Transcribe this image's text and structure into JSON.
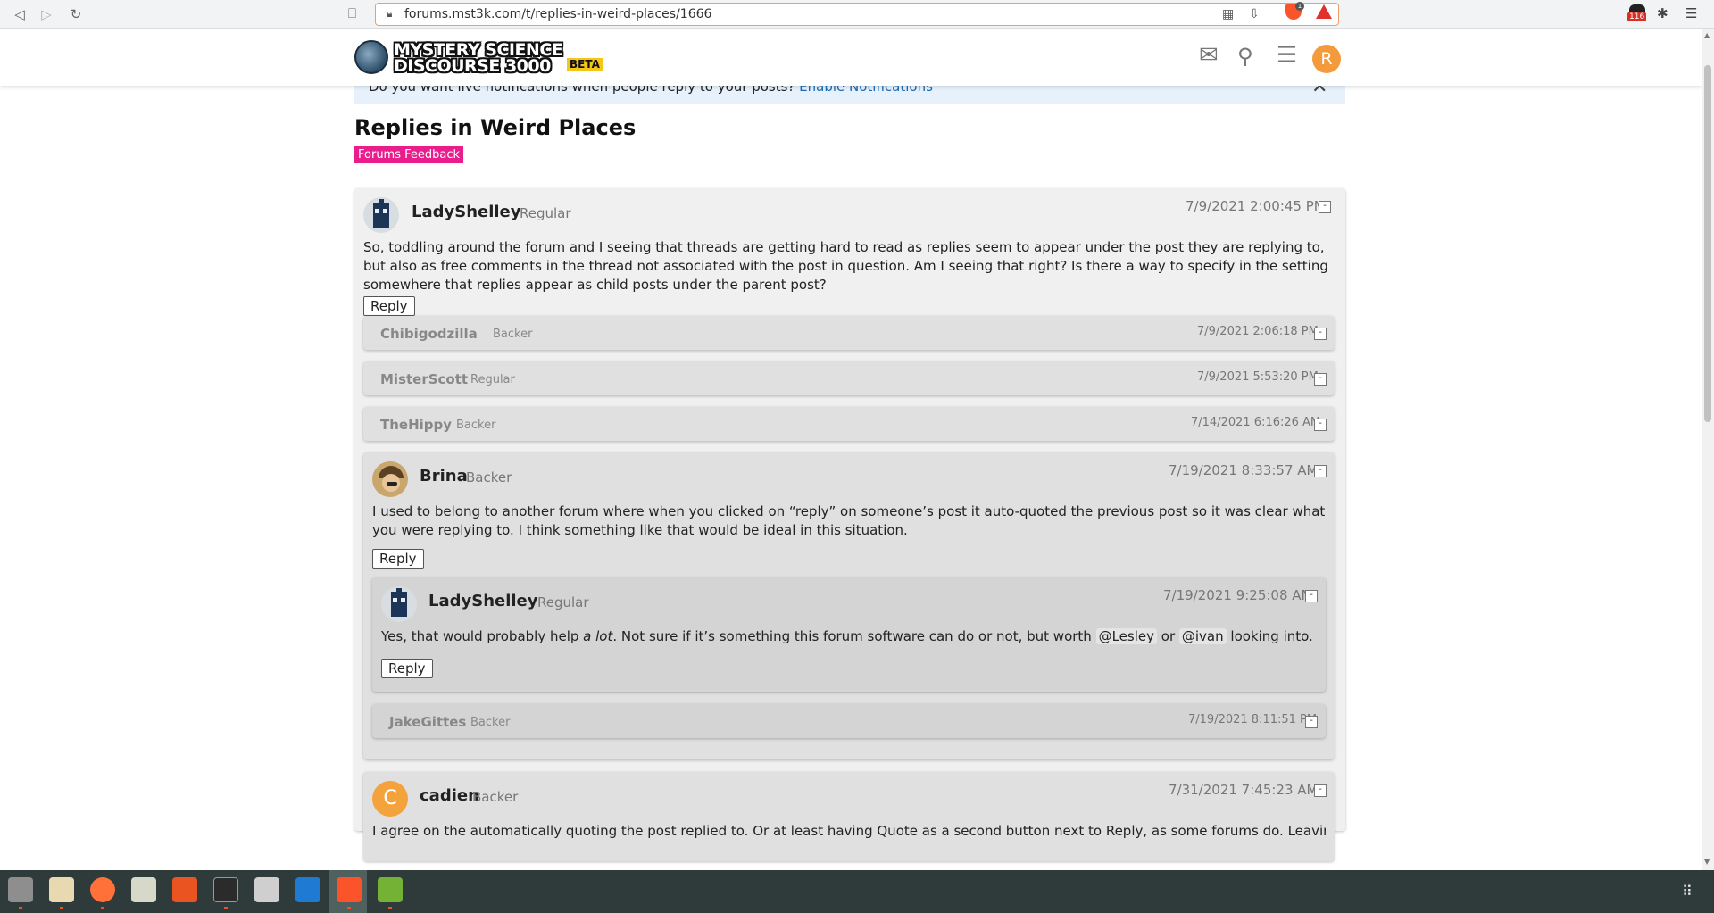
{
  "browser": {
    "url": "forums.mst3k.com/t/replies-in-weird-places/1666",
    "shield_count": "1",
    "extension_badge": "116"
  },
  "site": {
    "logo_line1": "MYSTERY SCIENCE",
    "logo_line2": "DISCOURSE 3000",
    "logo_beta": "BETA",
    "avatar_letter": "R"
  },
  "notice": {
    "text": "Do you want live notifications when people reply to your posts?",
    "link": "Enable Notifications"
  },
  "topic": {
    "title": "Replies in Weird Places",
    "category": "Forums Feedback",
    "category_color": "#e91e8c"
  },
  "reply_label": "Reply",
  "collapse_symbol": "-",
  "posts": {
    "p1": {
      "user": "LadyShelley",
      "role": "Regular",
      "time": "7/9/2021 2:00:45 PM",
      "body": "So, toddling around the forum and I seeing that threads are getting hard to read as replies seem to appear under the post they are replying to, but also as free comments in the thread not associated with the post in question. Am I seeing that right? Is there a way to specify in the setting somewhere that replies appear as child posts under the parent post?"
    },
    "c1": {
      "user": "Chibigodzilla",
      "role": "Backer",
      "time": "7/9/2021 2:06:18 PM"
    },
    "c2": {
      "user": "MisterScott",
      "role": "Regular",
      "time": "7/9/2021 5:53:20 PM"
    },
    "c3": {
      "user": "TheHippy",
      "role": "Backer",
      "time": "7/14/2021 6:16:26 AM"
    },
    "p2": {
      "user": "Brina",
      "role": "Backer",
      "time": "7/19/2021 8:33:57 AM",
      "body": "I used to belong to another forum where when you clicked on “reply” on someone’s post it auto-quoted the previous post so it was clear what you were replying to. I think something like that would be ideal in this situation."
    },
    "p3": {
      "user": "LadyShelley",
      "role": "Regular",
      "time": "7/19/2021 9:25:08 AM",
      "body_start": "Yes, that would probably help ",
      "body_em": "a lot",
      "body_mid": ". Not sure if it’s something this forum software can do or not, but worth ",
      "mention1": "@Lesley",
      "body_or": " or ",
      "mention2": "@ivan",
      "body_end": " looking into."
    },
    "c4": {
      "user": "JakeGittes",
      "role": "Backer",
      "time": "7/19/2021 8:11:51 PM"
    },
    "p4": {
      "user": "cadien",
      "role": "Backer",
      "time": "7/31/2021 7:45:23 AM",
      "avatar_letter": "C",
      "body_partial": "I agree on the automatically quoting the post replied to. Or at least having Quote as a second button next to Reply, as some forums do. Leaving out the"
    }
  },
  "colors": {
    "accent_link": "#1a6bb5",
    "notice_bg": "#e6f1fb",
    "avatar_r": "#f39a3d",
    "avatar_c": "#f4a23b"
  }
}
